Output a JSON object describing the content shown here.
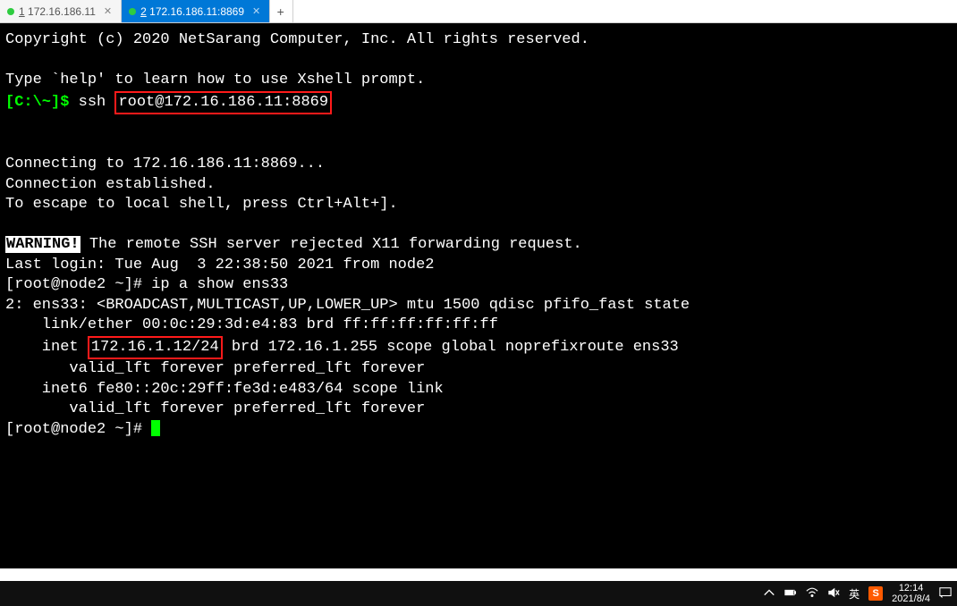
{
  "tabs": {
    "t1": {
      "num": "1",
      "label": "172.16.186.11"
    },
    "t2": {
      "num": "2",
      "label": "172.16.186.11:8869"
    }
  },
  "term": {
    "copyright": "Copyright (c) 2020 NetSarang Computer, Inc. All rights reserved.",
    "help": "Type `help' to learn how to use Xshell prompt.",
    "prompt_local": "[C:\\~]$ ",
    "ssh_cmd_pre": "ssh ",
    "ssh_cmd_box": "root@172.16.186.11:8869",
    "connecting": "Connecting to 172.16.186.11:8869...",
    "established": "Connection established.",
    "escape": "To escape to local shell, press Ctrl+Alt+].",
    "warn_label": "WARNING!",
    "warn_text": " The remote SSH server rejected X11 forwarding request.",
    "lastlogin": "Last login: Tue Aug  3 22:38:50 2021 from node2",
    "ps1": "[root@node2 ~]# ",
    "cmd_ipa": "ip a show ens33",
    "ifhdr": "2: ens33: <BROADCAST,MULTICAST,UP,LOWER_UP> mtu 1500 qdisc pfifo_fast state ",
    "link": "    link/ether 00:0c:29:3d:e4:83 brd ff:ff:ff:ff:ff:ff",
    "inet_pre": "    inet ",
    "inet_box": "172.16.1.12/24",
    "inet_post": " brd 172.16.1.255 scope global noprefixroute ens33",
    "valid1": "       valid_lft forever preferred_lft forever",
    "inet6": "    inet6 fe80::20c:29ff:fe3d:e483/64 scope link ",
    "valid2": "       valid_lft forever preferred_lft forever"
  },
  "taskbar": {
    "ime_lang": "英",
    "ime_brand": "S",
    "time": "12:14",
    "date": "2021/8/4"
  }
}
